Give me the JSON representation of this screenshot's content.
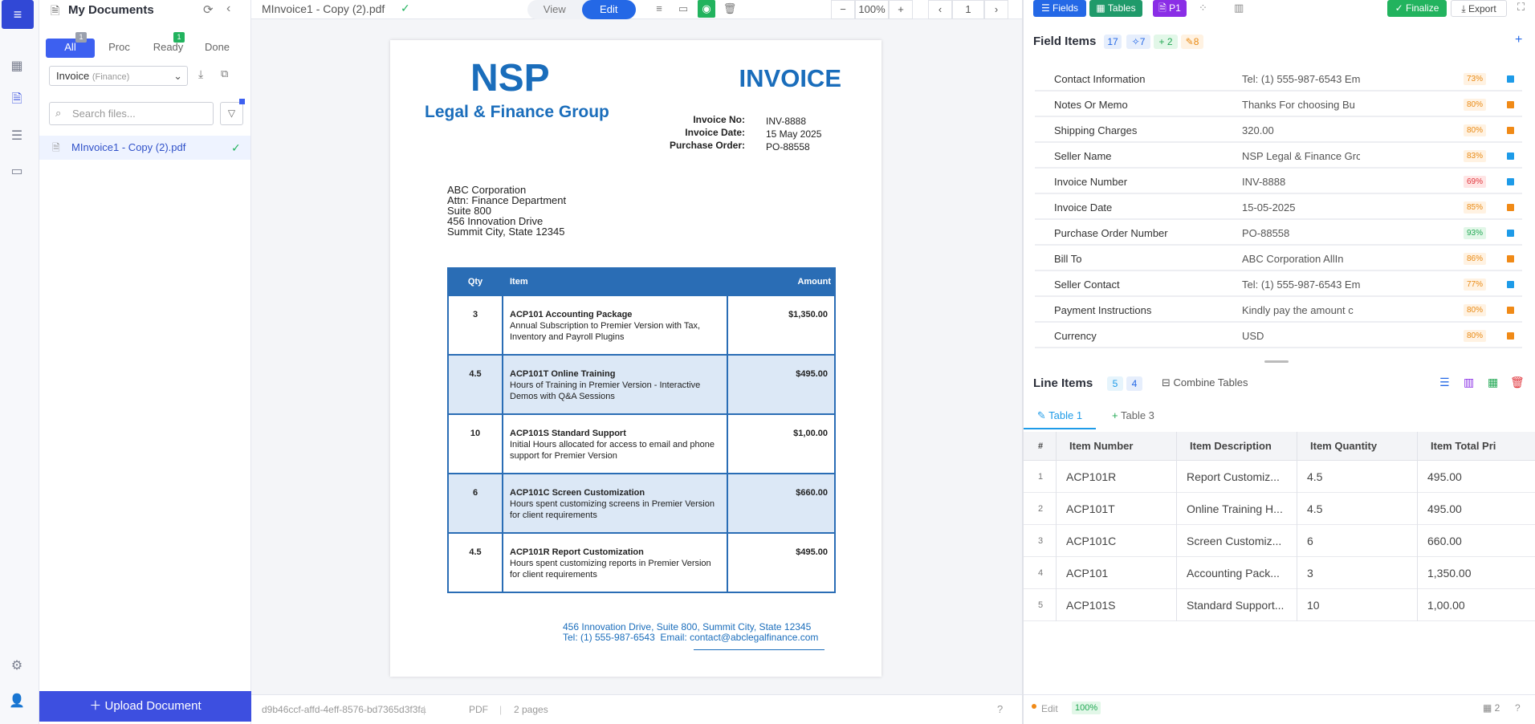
{
  "docs_panel": {
    "title": "My Documents",
    "tabs": [
      {
        "label": "All",
        "badge": "1"
      },
      {
        "label": "Proc",
        "badge": ""
      },
      {
        "label": "Ready",
        "badge": "1"
      },
      {
        "label": "Done",
        "badge": ""
      }
    ],
    "doc_type": "Invoice",
    "doc_category": "(Finance)",
    "search_placeholder": "Search files...",
    "files": [
      {
        "name": "MInvoice1 - Copy (2).pdf"
      }
    ],
    "upload_label": "Upload Document"
  },
  "viewer": {
    "filename": "MInvoice1 - Copy (2).pdf",
    "mode_view": "View",
    "mode_edit": "Edit",
    "zoom": "100%",
    "page": "1",
    "doc_id": "d9b46ccf-affd-4eff-8576-bd7365d3f3fa",
    "format": "PDF",
    "pages": "2 pages"
  },
  "invoice": {
    "company": "NSP",
    "company_sub": "Legal & Finance Group",
    "title": "INVOICE",
    "meta": [
      {
        "label": "Invoice No:",
        "value": "INV-8888"
      },
      {
        "label": "Invoice Date:",
        "value": "15 May 2025"
      },
      {
        "label": "Purchase Order:",
        "value": "PO-88558"
      }
    ],
    "bill_to": [
      "ABC Corporation",
      "Attn: Finance Department",
      "Suite 800",
      "456 Innovation Drive",
      "Summit City, State 12345"
    ],
    "table_headers": {
      "qty": "Qty",
      "item": "Item",
      "amount": "Amount"
    },
    "items": [
      {
        "qty": "3",
        "name": "ACP101 Accounting Package",
        "desc": "Annual Subscription to Premier Version with Tax, Inventory and Payroll Plugins",
        "amount": "$1,350.00"
      },
      {
        "qty": "4.5",
        "name": "ACP101T Online Training",
        "desc": "Hours of Training in Premier Version - Interactive Demos with Q&A Sessions",
        "amount": "$495.00"
      },
      {
        "qty": "10",
        "name": "ACP101S Standard Support",
        "desc": "Initial Hours allocated for access to email and phone support for Premier Version",
        "amount": "$1,00.00"
      },
      {
        "qty": "6",
        "name": "ACP101C Screen Customization",
        "desc": "Hours spent customizing screens in Premier Version for client requirements",
        "amount": "$660.00"
      },
      {
        "qty": "4.5",
        "name": "ACP101R Report Customization",
        "desc": "Hours spent customizing reports in Premier Version for client requirements",
        "amount": "$495.00"
      }
    ],
    "footer_line1": "456 Innovation Drive, Suite 800, Summit City, State 12345",
    "footer_tel": "Tel: (1) 555-987-6543",
    "footer_email_label": "Email:",
    "footer_email": "contact@abclegalfinance.com"
  },
  "right_panel": {
    "buttons": {
      "fields": "Fields",
      "tables": "Tables",
      "page": "P1",
      "finalize": "Finalize",
      "export": "Export"
    },
    "field_items_title": "Field Items",
    "field_counts": {
      "total": "17",
      "ai": "7",
      "added": "+ 2",
      "edited": "8"
    },
    "fields": [
      {
        "label": "Contact Information",
        "value": "Tel: (1) 555-987-6543 Ema",
        "conf": "73%",
        "level": "o",
        "dot": "#1e9be8"
      },
      {
        "label": "Notes Or Memo",
        "value": "Thanks For choosing Bu",
        "conf": "80%",
        "level": "o",
        "dot": "#f08a17"
      },
      {
        "label": "Shipping Charges",
        "value": "320.00",
        "conf": "80%",
        "level": "o",
        "dot": "#f08a17"
      },
      {
        "label": "Seller Name",
        "value": "NSP Legal & Finance Grc",
        "conf": "83%",
        "level": "o",
        "dot": "#1e9be8"
      },
      {
        "label": "Invoice Number",
        "value": "INV-8888",
        "conf": "69%",
        "level": "r",
        "dot": "#1e9be8"
      },
      {
        "label": "Invoice Date",
        "value": "15-05-2025",
        "conf": "85%",
        "level": "o",
        "dot": "#f08a17"
      },
      {
        "label": "Purchase Order Number",
        "value": "PO-88558",
        "conf": "93%",
        "level": "g",
        "dot": "#1e9be8"
      },
      {
        "label": "Bill To",
        "value": "ABC Corporation AllIn",
        "conf": "86%",
        "level": "o",
        "dot": "#f08a17"
      },
      {
        "label": "Seller Contact",
        "value": "Tel: (1) 555-987-6543 Ema",
        "conf": "77%",
        "level": "o",
        "dot": "#1e9be8"
      },
      {
        "label": "Payment Instructions",
        "value": "Kindly pay the amount c",
        "conf": "80%",
        "level": "o",
        "dot": "#f08a17"
      },
      {
        "label": "Currency",
        "value": "USD",
        "conf": "80%",
        "level": "o",
        "dot": "#f08a17"
      }
    ],
    "line_items_title": "Line Items",
    "line_counts": {
      "a": "5",
      "b": "4"
    },
    "combine_label": "Combine Tables",
    "table_tabs": [
      "Table 1",
      "Table 3"
    ],
    "columns": [
      "#",
      "Item Number",
      "Item Description",
      "Item Quantity",
      "Item Total Pri"
    ],
    "rows": [
      {
        "n": "1",
        "num": "ACP101R",
        "desc": "Report Customiz...",
        "qty": "4.5",
        "total": "495.00"
      },
      {
        "n": "2",
        "num": "ACP101T",
        "desc": "Online Training H...",
        "qty": "4.5",
        "total": "495.00"
      },
      {
        "n": "3",
        "num": "ACP101C",
        "desc": "Screen Customiz...",
        "qty": "6",
        "total": "660.00"
      },
      {
        "n": "4",
        "num": "ACP101",
        "desc": "Accounting Pack...",
        "qty": "3",
        "total": "1,350.00"
      },
      {
        "n": "5",
        "num": "ACP101S",
        "desc": "Standard Support...",
        "qty": "10",
        "total": "1,00.00"
      }
    ],
    "status": {
      "mode": "Edit",
      "pct": "100%",
      "tables": "2"
    }
  }
}
